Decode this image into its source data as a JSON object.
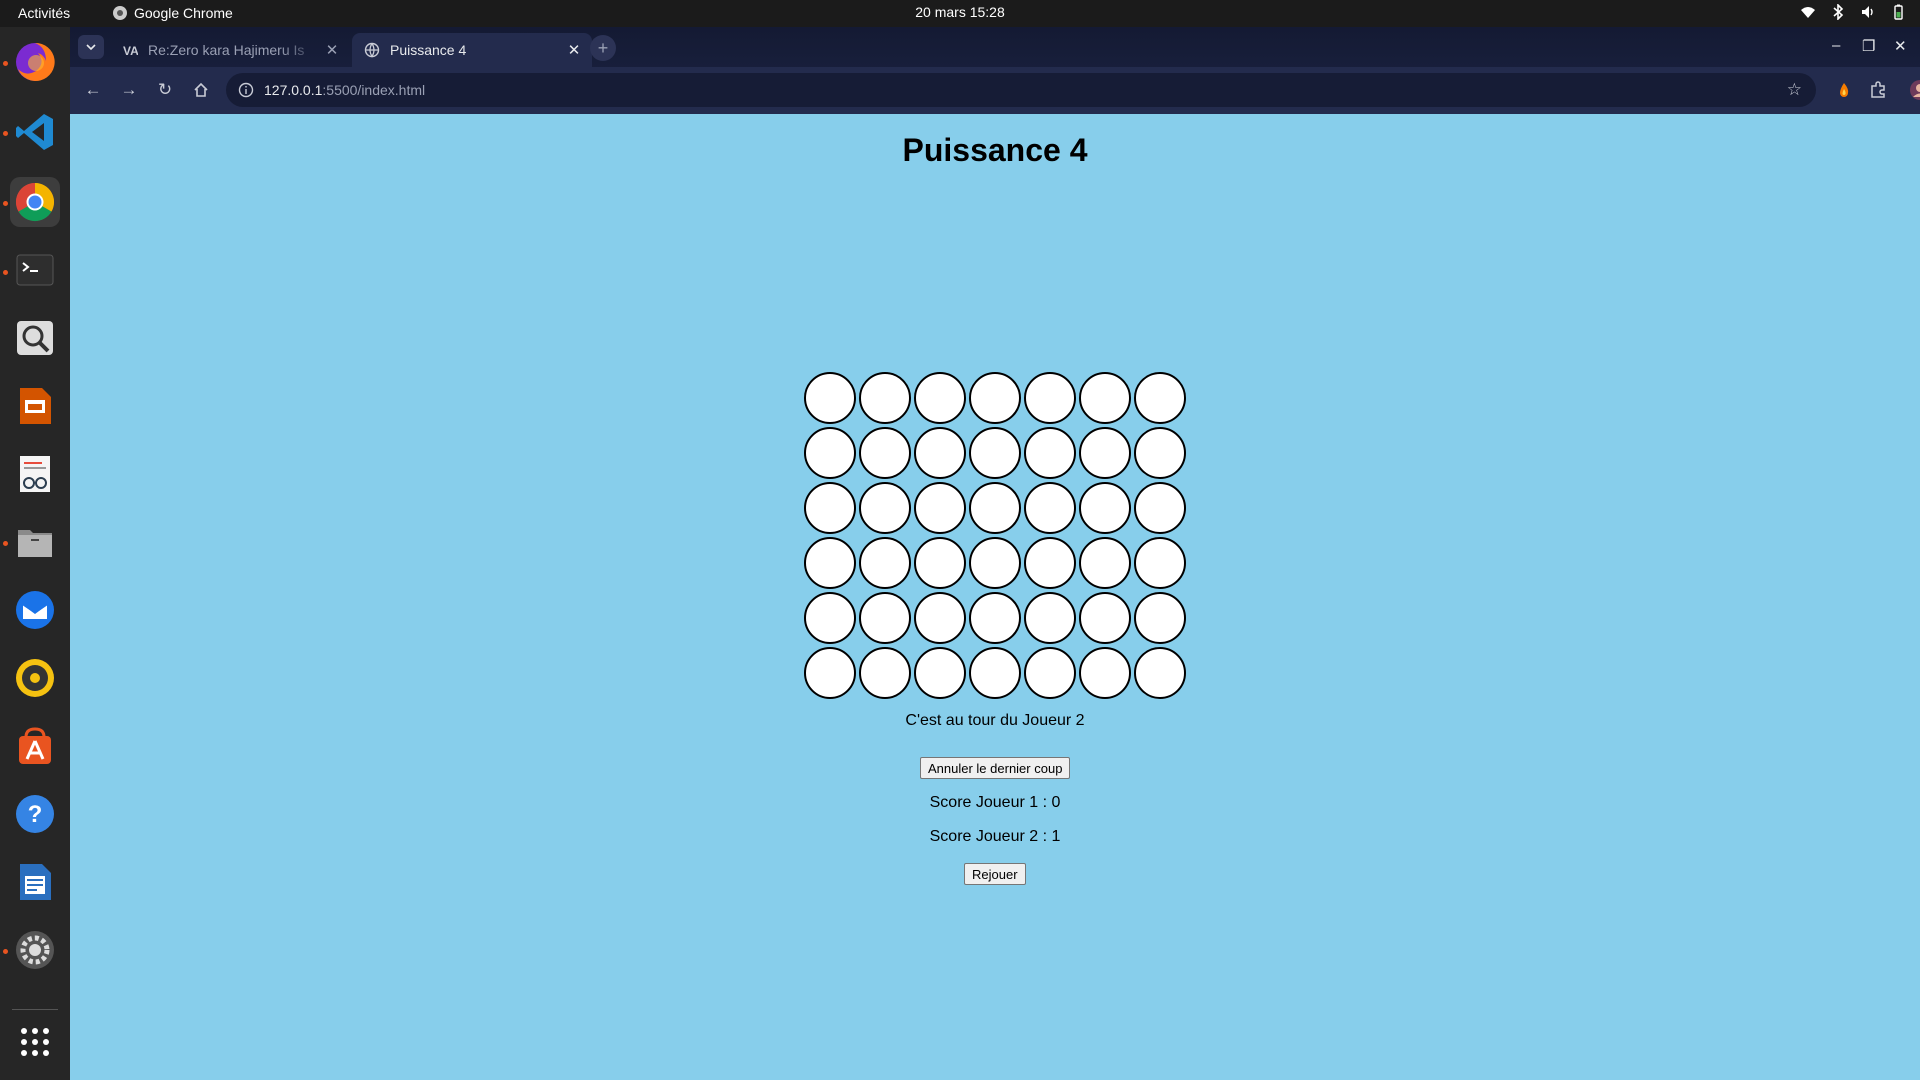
{
  "topbar": {
    "activities": "Activités",
    "app_name": "Google Chrome",
    "clock": "20 mars  15:28"
  },
  "dock": {
    "items": [
      {
        "name": "firefox",
        "icon": "firefox-icon",
        "running": true
      },
      {
        "name": "vscode",
        "icon": "vscode-icon",
        "running": true
      },
      {
        "name": "chrome",
        "icon": "chrome-icon",
        "running": true,
        "active": true
      },
      {
        "name": "terminal",
        "icon": "terminal-icon",
        "running": true
      },
      {
        "name": "image-viewer",
        "icon": "magnifier-icon",
        "running": false
      },
      {
        "name": "impress",
        "icon": "presentation-icon",
        "running": false
      },
      {
        "name": "document-viewer",
        "icon": "document-viewer-icon",
        "running": false
      },
      {
        "name": "files",
        "icon": "files-icon",
        "running": true
      },
      {
        "name": "thunderbird",
        "icon": "thunderbird-icon",
        "running": false
      },
      {
        "name": "rhythmbox",
        "icon": "music-icon",
        "running": false
      },
      {
        "name": "app-center",
        "icon": "app-center-icon",
        "running": false
      },
      {
        "name": "help",
        "icon": "help-icon",
        "running": false
      },
      {
        "name": "writer",
        "icon": "writer-icon",
        "running": false
      },
      {
        "name": "settings",
        "icon": "settings-icon",
        "running": true
      }
    ]
  },
  "browser": {
    "tabs": [
      {
        "title": "Re:Zero kara Hajimeru Is",
        "active": false
      },
      {
        "title": "Puissance 4",
        "active": true
      }
    ],
    "url_host": "127.0.0.1",
    "url_path": ":5500/index.html"
  },
  "game": {
    "title": "Puissance 4",
    "rows": 6,
    "cols": 7,
    "board": [
      [
        0,
        0,
        0,
        0,
        0,
        0,
        0
      ],
      [
        0,
        0,
        0,
        0,
        0,
        0,
        0
      ],
      [
        0,
        0,
        0,
        0,
        0,
        0,
        0
      ],
      [
        0,
        0,
        0,
        0,
        0,
        0,
        0
      ],
      [
        0,
        0,
        0,
        0,
        0,
        0,
        0
      ],
      [
        0,
        0,
        0,
        0,
        0,
        0,
        0
      ]
    ],
    "status": "C'est au tour du Joueur 2",
    "undo_label": "Annuler le dernier coup",
    "score1": "Score Joueur 1 : 0",
    "score2": "Score Joueur 2 : 1",
    "replay_label": "Rejouer",
    "colors": {
      "background": "#87CEEB",
      "empty": "#ffffff",
      "border": "#000000"
    }
  }
}
